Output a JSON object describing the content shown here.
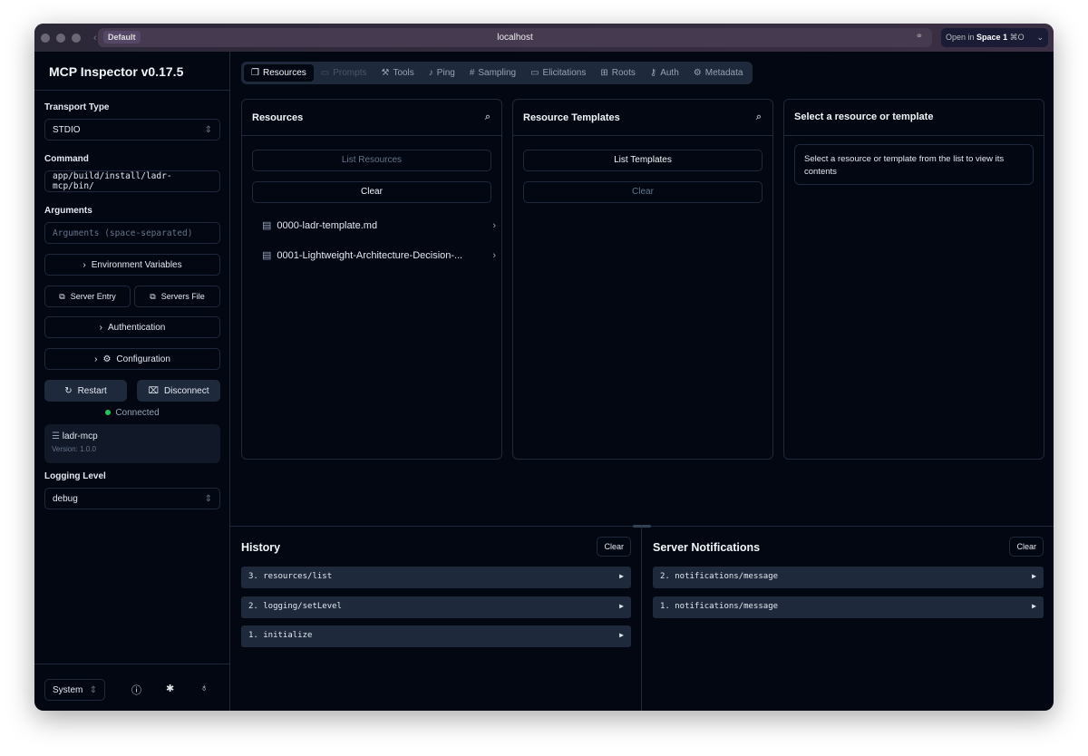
{
  "browser": {
    "profile": "Default",
    "url": "localhost",
    "open_in_prefix": "Open in",
    "open_in_space": "Space 1",
    "shortcut": "⌘O"
  },
  "sidebar": {
    "title": "MCP Inspector v0.17.5",
    "transport_label": "Transport Type",
    "transport_value": "STDIO",
    "command_label": "Command",
    "command_value": "app/build/install/ladr-mcp/bin/",
    "arguments_label": "Arguments",
    "arguments_placeholder": "Arguments (space-separated)",
    "env_vars": "Environment Variables",
    "server_entry": "Server Entry",
    "servers_file": "Servers File",
    "authentication": "Authentication",
    "configuration": "Configuration",
    "restart": "Restart",
    "disconnect": "Disconnect",
    "status": "Connected",
    "status_color": "#22c55e",
    "server_name": "ladr-mcp",
    "server_version": "Version: 1.0.0",
    "logging_label": "Logging Level",
    "logging_value": "debug",
    "theme": "System"
  },
  "tabs": [
    {
      "label": "Resources",
      "icon": "files-icon"
    },
    {
      "label": "Prompts",
      "icon": "message-icon"
    },
    {
      "label": "Tools",
      "icon": "hammer-icon"
    },
    {
      "label": "Ping",
      "icon": "bell-icon"
    },
    {
      "label": "Sampling",
      "icon": "hash-icon"
    },
    {
      "label": "Elicitations",
      "icon": "message-icon"
    },
    {
      "label": "Roots",
      "icon": "folder-tree-icon"
    },
    {
      "label": "Auth",
      "icon": "key-icon"
    },
    {
      "label": "Metadata",
      "icon": "gear-icon"
    }
  ],
  "resources": {
    "title": "Resources",
    "list_btn": "List Resources",
    "clear_btn": "Clear",
    "items": [
      "0000-ladr-template.md",
      "0001-Lightweight-Architecture-Decision-..."
    ]
  },
  "templates": {
    "title": "Resource Templates",
    "list_btn": "List Templates",
    "clear_btn": "Clear"
  },
  "detail": {
    "title": "Select a resource or template",
    "message": "Select a resource or template from the list to view its contents"
  },
  "history": {
    "title": "History",
    "clear": "Clear",
    "items": [
      "3. resources/list",
      "2. logging/setLevel",
      "1. initialize"
    ]
  },
  "notifications": {
    "title": "Server Notifications",
    "clear": "Clear",
    "items": [
      "2. notifications/message",
      "1. notifications/message"
    ]
  }
}
